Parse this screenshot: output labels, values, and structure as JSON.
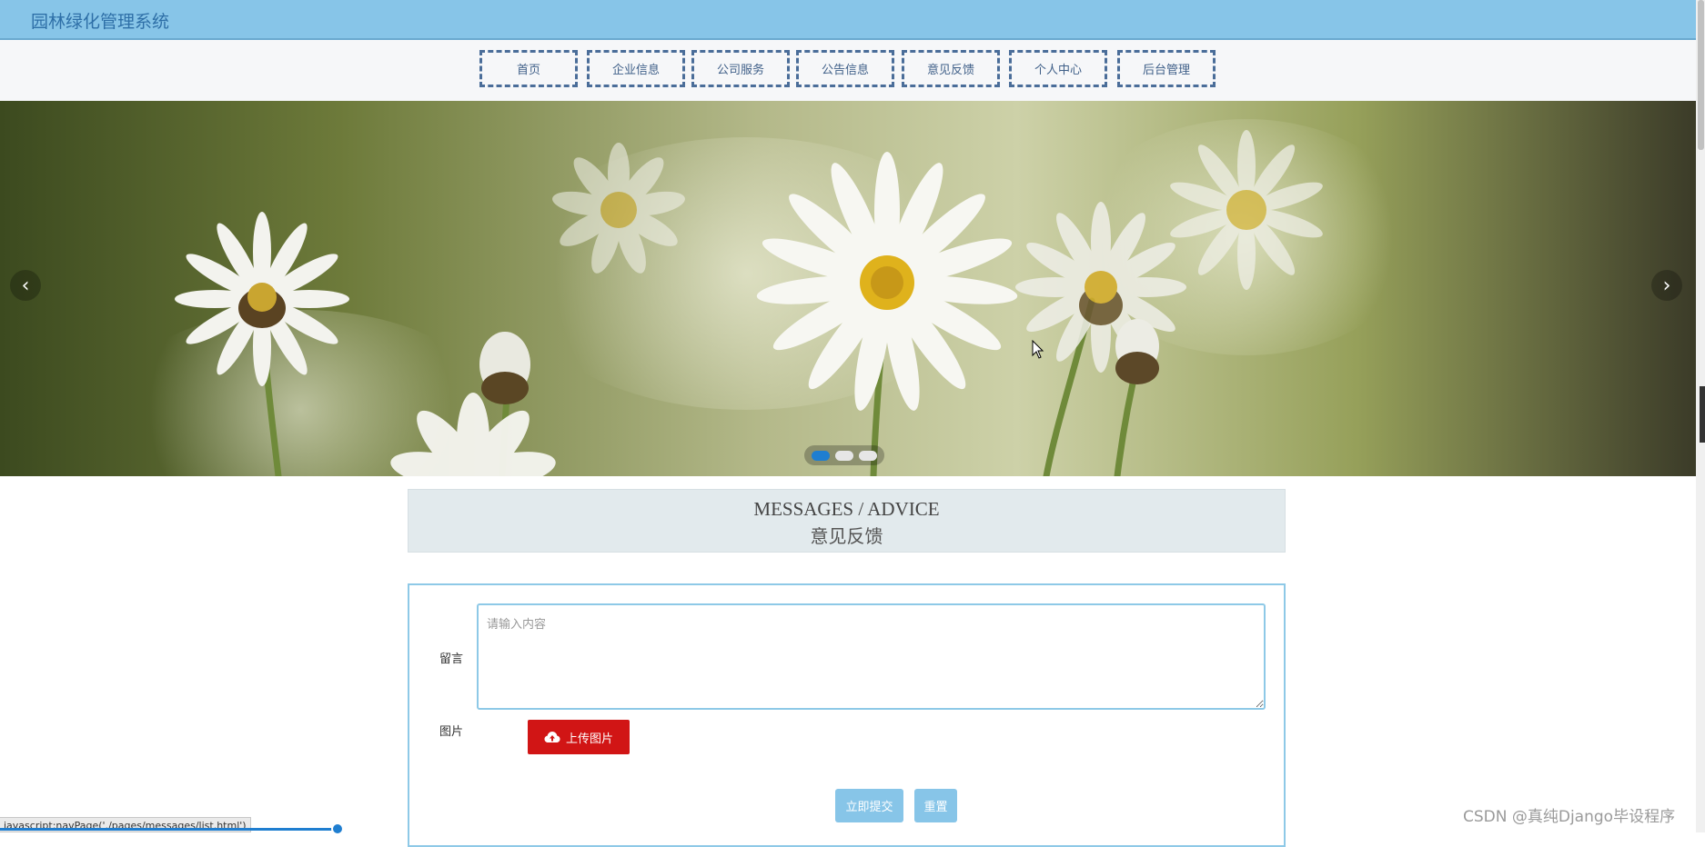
{
  "header": {
    "title": "园林绿化管理系统"
  },
  "nav": {
    "items": [
      "首页",
      "企业信息",
      "公司服务",
      "公告信息",
      "意见反馈",
      "个人中心",
      "后台管理"
    ]
  },
  "carousel": {
    "prev_icon": "chevron-left-icon",
    "next_icon": "chevron-right-icon",
    "slide_count": 3,
    "active_index": 0
  },
  "section": {
    "title_en": "MESSAGES / ADVICE",
    "title_cn": "意见反馈"
  },
  "form": {
    "message_label": "留言",
    "message_placeholder": "请输入内容",
    "message_value": "",
    "image_label": "图片",
    "upload_label": "上传图片",
    "upload_icon": "cloud-upload-icon",
    "submit_label": "立即提交",
    "reset_label": "重置"
  },
  "statusbar": {
    "text": "javascript:navPage('./pages/messages/list.html')"
  },
  "watermark": {
    "text": "CSDN @真纯Django毕设程序"
  },
  "colors": {
    "topbar": "#87c5e8",
    "nav_border": "#4a6d99",
    "upload_button": "#d11515",
    "primary_button": "#87c5e8",
    "active_dot": "#1f7ed0"
  }
}
